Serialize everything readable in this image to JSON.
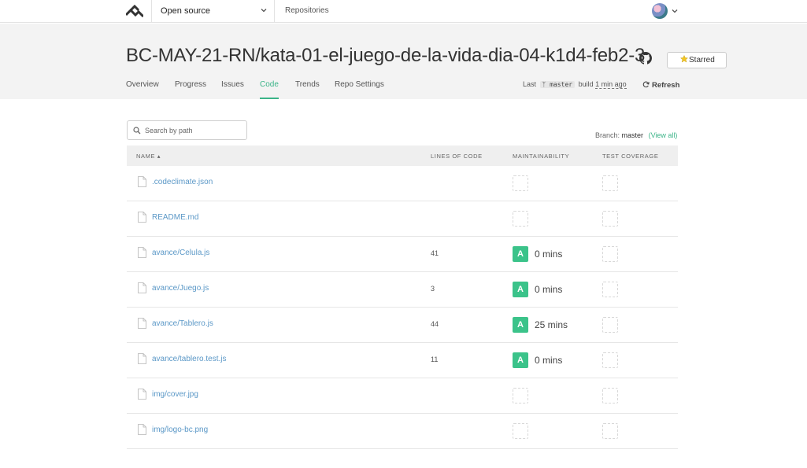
{
  "nav": {
    "org_label": "Open source",
    "repositories_label": "Repositories"
  },
  "header": {
    "repo_title": "BC-MAY-21-RN/kata-01-el-juego-de-la-vida-dia-04-k1d4-feb2-3",
    "starred_label": "Starred",
    "tabs": [
      "Overview",
      "Progress",
      "Issues",
      "Code",
      "Trends",
      "Repo Settings"
    ],
    "active_tab": "Code",
    "last_label": "Last",
    "branch": "master",
    "build_label": "build",
    "build_ago": "1 min ago",
    "refresh_label": "Refresh"
  },
  "search": {
    "placeholder": "Search by path"
  },
  "branch_info": {
    "label": "Branch:",
    "branch": "master",
    "view_all": "(View all)"
  },
  "table": {
    "headers": {
      "name": "NAME",
      "loc": "LINES OF CODE",
      "maint": "MAINTAINABILITY",
      "coverage": "TEST COVERAGE"
    },
    "rows": [
      {
        "name": ".codeclimate.json",
        "loc": "",
        "grade": "",
        "time": ""
      },
      {
        "name": "README.md",
        "loc": "",
        "grade": "",
        "time": ""
      },
      {
        "name": "avance/Celula.js",
        "loc": "41",
        "grade": "A",
        "time": "0 mins"
      },
      {
        "name": "avance/Juego.js",
        "loc": "3",
        "grade": "A",
        "time": "0 mins"
      },
      {
        "name": "avance/Tablero.js",
        "loc": "44",
        "grade": "A",
        "time": "25 mins"
      },
      {
        "name": "avance/tablero.test.js",
        "loc": "11",
        "grade": "A",
        "time": "0 mins"
      },
      {
        "name": "img/cover.jpg",
        "loc": "",
        "grade": "",
        "time": ""
      },
      {
        "name": "img/logo-bc.png",
        "loc": "",
        "grade": "",
        "time": ""
      }
    ]
  },
  "colors": {
    "accent": "#3bb488",
    "grade_a": "#3bc38a",
    "link": "#5b98c7"
  }
}
